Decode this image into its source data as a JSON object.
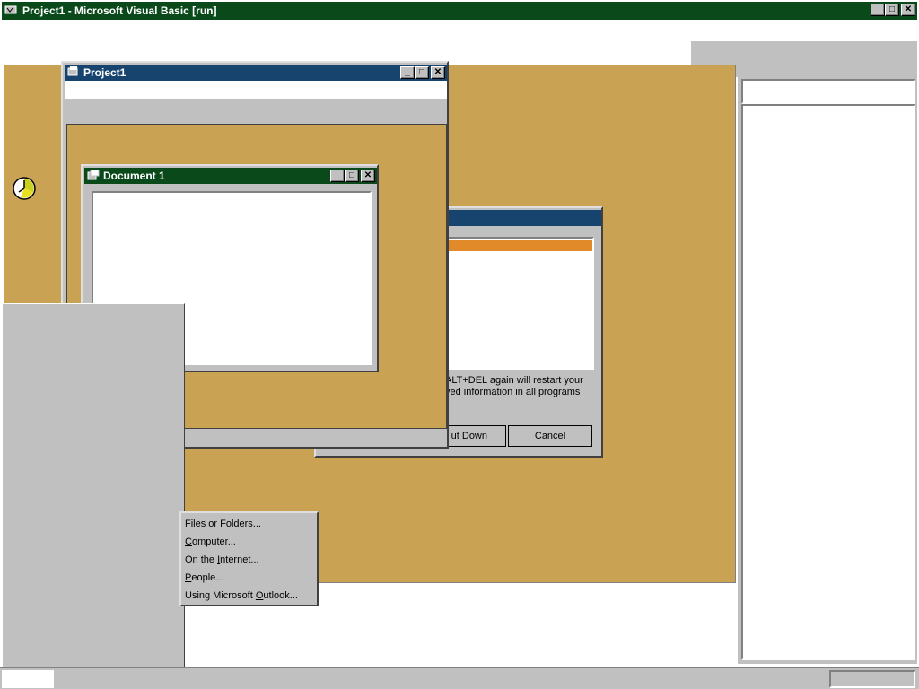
{
  "app": {
    "title": "Project1 - Microsoft Visual Basic [run]"
  },
  "project_window": {
    "title": "Project1"
  },
  "document_window": {
    "title": "Document 1"
  },
  "shutdown_dialog": {
    "message_line1": "ALT+DEL again will restart your",
    "message_line2": "ved information in all programs",
    "shutdown_label": "ut Down",
    "cancel_label": "Cancel"
  },
  "find_menu": {
    "items": [
      {
        "label_u": "F",
        "label_rest": "iles or Folders..."
      },
      {
        "label_u": "C",
        "label_rest": "omputer..."
      },
      {
        "label_pre": "On the ",
        "label_u": "I",
        "label_rest": "nternet..."
      },
      {
        "label_u": "P",
        "label_rest": "eople..."
      },
      {
        "label_pre": "Using Microsoft ",
        "label_u": "O",
        "label_rest": "utlook..."
      }
    ]
  },
  "caption_buttons": {
    "minimize": "_",
    "maximize": "□",
    "close": "✕"
  },
  "colors": {
    "mdi_background": "#c9a254",
    "title_green": "#0a4a1a",
    "title_blue": "#16446e",
    "selection_orange": "#e08a2a"
  },
  "icons": {
    "app": "vb-app-icon",
    "project": "project-icon",
    "document": "document-icon",
    "clock": "clock-icon"
  }
}
